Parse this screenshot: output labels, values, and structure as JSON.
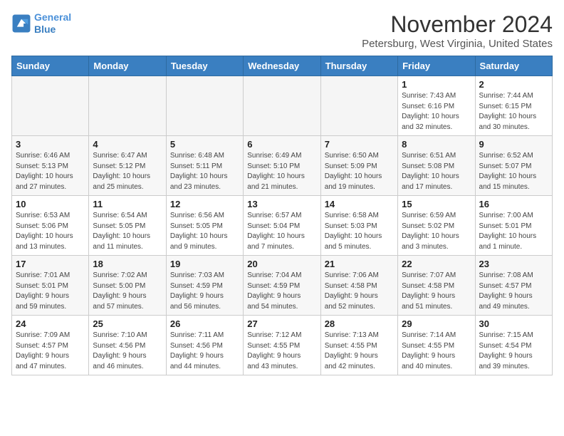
{
  "header": {
    "logo_line1": "General",
    "logo_line2": "Blue",
    "month": "November 2024",
    "location": "Petersburg, West Virginia, United States"
  },
  "weekdays": [
    "Sunday",
    "Monday",
    "Tuesday",
    "Wednesday",
    "Thursday",
    "Friday",
    "Saturday"
  ],
  "weeks": [
    [
      {
        "day": "",
        "info": "",
        "empty": true
      },
      {
        "day": "",
        "info": "",
        "empty": true
      },
      {
        "day": "",
        "info": "",
        "empty": true
      },
      {
        "day": "",
        "info": "",
        "empty": true
      },
      {
        "day": "",
        "info": "",
        "empty": true
      },
      {
        "day": "1",
        "info": "Sunrise: 7:43 AM\nSunset: 6:16 PM\nDaylight: 10 hours\nand 32 minutes."
      },
      {
        "day": "2",
        "info": "Sunrise: 7:44 AM\nSunset: 6:15 PM\nDaylight: 10 hours\nand 30 minutes."
      }
    ],
    [
      {
        "day": "3",
        "info": "Sunrise: 6:46 AM\nSunset: 5:13 PM\nDaylight: 10 hours\nand 27 minutes."
      },
      {
        "day": "4",
        "info": "Sunrise: 6:47 AM\nSunset: 5:12 PM\nDaylight: 10 hours\nand 25 minutes."
      },
      {
        "day": "5",
        "info": "Sunrise: 6:48 AM\nSunset: 5:11 PM\nDaylight: 10 hours\nand 23 minutes."
      },
      {
        "day": "6",
        "info": "Sunrise: 6:49 AM\nSunset: 5:10 PM\nDaylight: 10 hours\nand 21 minutes."
      },
      {
        "day": "7",
        "info": "Sunrise: 6:50 AM\nSunset: 5:09 PM\nDaylight: 10 hours\nand 19 minutes."
      },
      {
        "day": "8",
        "info": "Sunrise: 6:51 AM\nSunset: 5:08 PM\nDaylight: 10 hours\nand 17 minutes."
      },
      {
        "day": "9",
        "info": "Sunrise: 6:52 AM\nSunset: 5:07 PM\nDaylight: 10 hours\nand 15 minutes."
      }
    ],
    [
      {
        "day": "10",
        "info": "Sunrise: 6:53 AM\nSunset: 5:06 PM\nDaylight: 10 hours\nand 13 minutes."
      },
      {
        "day": "11",
        "info": "Sunrise: 6:54 AM\nSunset: 5:05 PM\nDaylight: 10 hours\nand 11 minutes."
      },
      {
        "day": "12",
        "info": "Sunrise: 6:56 AM\nSunset: 5:05 PM\nDaylight: 10 hours\nand 9 minutes."
      },
      {
        "day": "13",
        "info": "Sunrise: 6:57 AM\nSunset: 5:04 PM\nDaylight: 10 hours\nand 7 minutes."
      },
      {
        "day": "14",
        "info": "Sunrise: 6:58 AM\nSunset: 5:03 PM\nDaylight: 10 hours\nand 5 minutes."
      },
      {
        "day": "15",
        "info": "Sunrise: 6:59 AM\nSunset: 5:02 PM\nDaylight: 10 hours\nand 3 minutes."
      },
      {
        "day": "16",
        "info": "Sunrise: 7:00 AM\nSunset: 5:01 PM\nDaylight: 10 hours\nand 1 minute."
      }
    ],
    [
      {
        "day": "17",
        "info": "Sunrise: 7:01 AM\nSunset: 5:01 PM\nDaylight: 9 hours\nand 59 minutes."
      },
      {
        "day": "18",
        "info": "Sunrise: 7:02 AM\nSunset: 5:00 PM\nDaylight: 9 hours\nand 57 minutes."
      },
      {
        "day": "19",
        "info": "Sunrise: 7:03 AM\nSunset: 4:59 PM\nDaylight: 9 hours\nand 56 minutes."
      },
      {
        "day": "20",
        "info": "Sunrise: 7:04 AM\nSunset: 4:59 PM\nDaylight: 9 hours\nand 54 minutes."
      },
      {
        "day": "21",
        "info": "Sunrise: 7:06 AM\nSunset: 4:58 PM\nDaylight: 9 hours\nand 52 minutes."
      },
      {
        "day": "22",
        "info": "Sunrise: 7:07 AM\nSunset: 4:58 PM\nDaylight: 9 hours\nand 51 minutes."
      },
      {
        "day": "23",
        "info": "Sunrise: 7:08 AM\nSunset: 4:57 PM\nDaylight: 9 hours\nand 49 minutes."
      }
    ],
    [
      {
        "day": "24",
        "info": "Sunrise: 7:09 AM\nSunset: 4:57 PM\nDaylight: 9 hours\nand 47 minutes."
      },
      {
        "day": "25",
        "info": "Sunrise: 7:10 AM\nSunset: 4:56 PM\nDaylight: 9 hours\nand 46 minutes."
      },
      {
        "day": "26",
        "info": "Sunrise: 7:11 AM\nSunset: 4:56 PM\nDaylight: 9 hours\nand 44 minutes."
      },
      {
        "day": "27",
        "info": "Sunrise: 7:12 AM\nSunset: 4:55 PM\nDaylight: 9 hours\nand 43 minutes."
      },
      {
        "day": "28",
        "info": "Sunrise: 7:13 AM\nSunset: 4:55 PM\nDaylight: 9 hours\nand 42 minutes."
      },
      {
        "day": "29",
        "info": "Sunrise: 7:14 AM\nSunset: 4:55 PM\nDaylight: 9 hours\nand 40 minutes."
      },
      {
        "day": "30",
        "info": "Sunrise: 7:15 AM\nSunset: 4:54 PM\nDaylight: 9 hours\nand 39 minutes."
      }
    ]
  ]
}
